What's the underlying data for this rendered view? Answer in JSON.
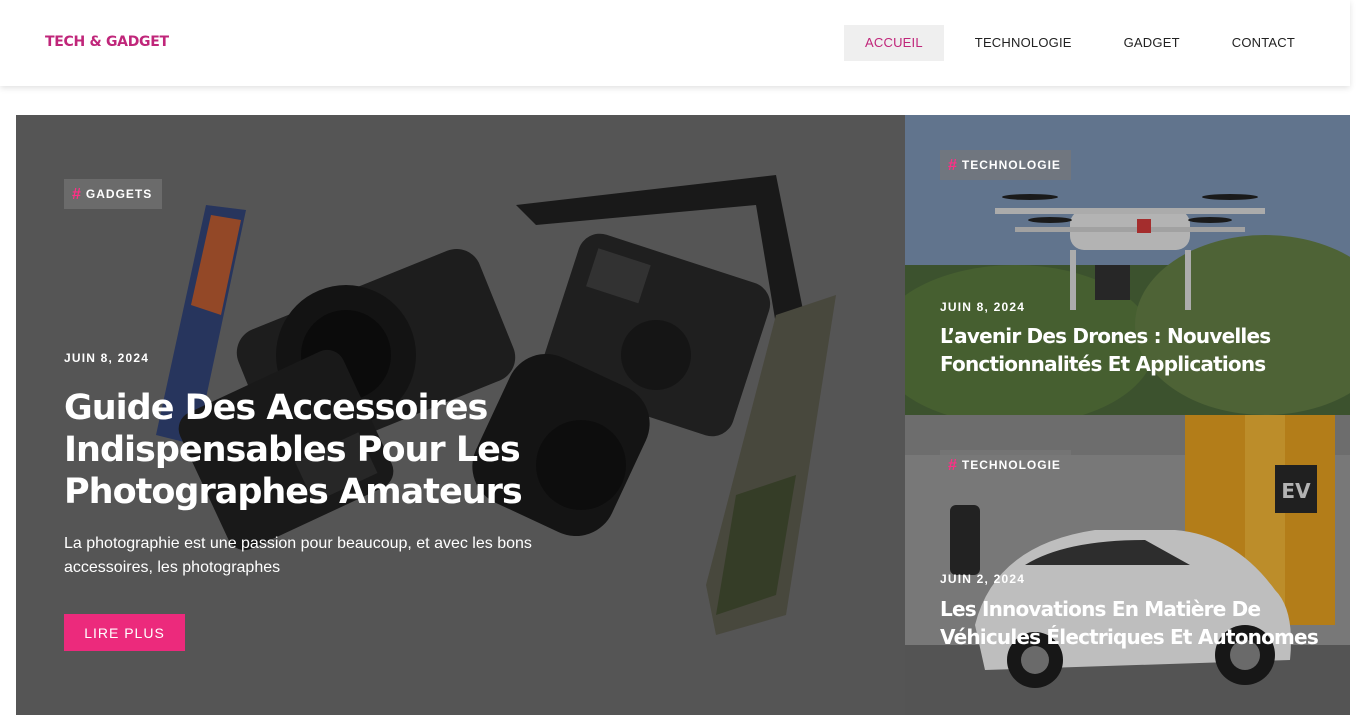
{
  "header": {
    "logo": "TECH & GADGET",
    "nav": [
      {
        "label": "ACCUEIL",
        "active": true
      },
      {
        "label": "TECHNOLOGIE",
        "active": false
      },
      {
        "label": "GADGET",
        "active": false
      },
      {
        "label": "CONTACT",
        "active": false
      }
    ]
  },
  "featured": {
    "tag": "GADGETS",
    "date": "JUIN 8, 2024",
    "title": "Guide Des Accessoires Indispensables Pour Les Photographes Amateurs",
    "excerpt": "La photographie est une passion pour beaucoup, et avec les bons accessoires, les photographes",
    "button": "LIRE PLUS"
  },
  "side_posts": [
    {
      "tag": "TECHNOLOGIE",
      "date": "JUIN 8, 2024",
      "title": "L’avenir Des Drones : Nouvelles Fonctionnalités Et Applications"
    },
    {
      "tag": "TECHNOLOGIE",
      "date": "JUIN 2, 2024",
      "title": "Les Innovations En Matière De Véhicules Électriques Et Autonomes"
    }
  ],
  "images": {
    "featured": "camera-photo",
    "side_top": "drone-photo",
    "side_bottom": "electric-car-photo",
    "ev_sign": "EV"
  },
  "colors": {
    "brand": "#c0267a",
    "accent": "#ec2a7c",
    "hash": "#ff2f86"
  }
}
